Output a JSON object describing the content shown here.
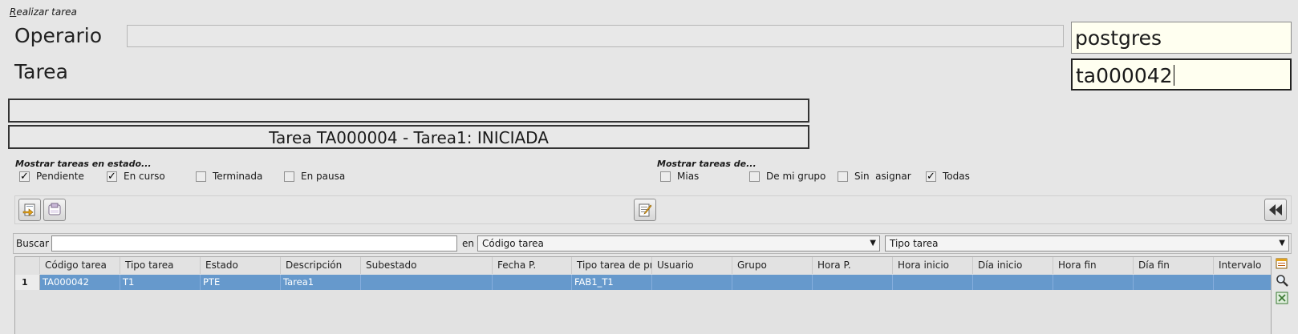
{
  "frame": {
    "title": "Realizar tarea",
    "title_first": "R",
    "title_rest": "ealizar tarea"
  },
  "operario": {
    "label": "Operario",
    "value": "postgres"
  },
  "tarea": {
    "label": "Tarea",
    "value": "ta000042"
  },
  "messages": {
    "line1": "",
    "line2": "Tarea TA000004 - Tarea1: INICIADA"
  },
  "estado_filter": {
    "title": "Mostrar tareas en estado...",
    "options": [
      {
        "label": "Pendiente",
        "checked": true
      },
      {
        "label": "En curso",
        "checked": true
      },
      {
        "label": "Terminada",
        "checked": false
      },
      {
        "label": "En pausa",
        "checked": false
      }
    ]
  },
  "owner_filter": {
    "title": "Mostrar tareas de...",
    "options": [
      {
        "label": "Mias",
        "checked": false
      },
      {
        "label": "De mi grupo",
        "checked": false
      },
      {
        "label": "Sin  asignar",
        "checked": false
      },
      {
        "label": "Todas",
        "checked": true
      }
    ]
  },
  "toolbar": {
    "icons": [
      "new-task-icon",
      "save-task-icon",
      "edit-note-icon",
      "rewind-icon"
    ]
  },
  "search": {
    "label": "Buscar",
    "value": "",
    "in_label": "en",
    "field_select": "Código tarea",
    "type_select": "Tipo tarea"
  },
  "grid": {
    "columns": [
      "Código tarea",
      "Tipo tarea",
      "Estado",
      "Descripción",
      "Subestado",
      "Fecha P.",
      "Tipo tarea de pr",
      "Usuario",
      "Grupo",
      "Hora P.",
      "Hora inicio",
      "Día inicio",
      "Hora fin",
      "Día fin",
      "Intervalo"
    ],
    "rows": [
      {
        "num": "1",
        "cells": [
          "TA000042",
          "T1",
          "PTE",
          "Tarea1",
          "",
          "",
          "FAB1_T1",
          "",
          "",
          "",
          "",
          "",
          "",
          "",
          ""
        ]
      }
    ],
    "side_icons": [
      "table-config-icon",
      "zoom-icon",
      "excel-export-icon"
    ]
  },
  "colors": {
    "selection": "#6699cc",
    "background": "#e6e6e6",
    "input_bg": "#fffff0"
  }
}
